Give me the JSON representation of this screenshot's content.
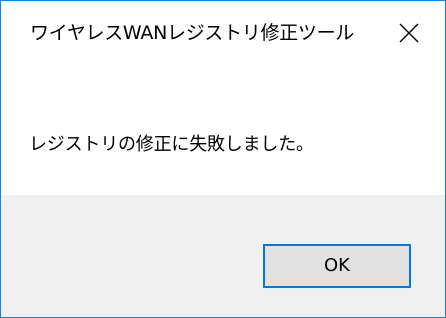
{
  "window": {
    "title": "ワイヤレスWANレジストリ修正ツール",
    "close_icon": "close-icon"
  },
  "content": {
    "message": "レジストリの修正に失敗しました。"
  },
  "buttons": {
    "ok_label": "OK"
  },
  "colors": {
    "accent": "#0078d7",
    "window_border": "#1883d7",
    "footer_bg": "#f0f0f0",
    "button_bg": "#e1e1e1"
  }
}
